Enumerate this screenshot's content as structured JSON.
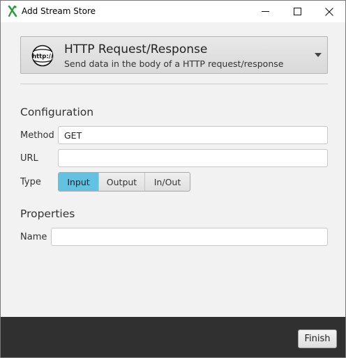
{
  "window": {
    "title": "Add Stream Store"
  },
  "store_select": {
    "title": "HTTP Request/Response",
    "description": "Send data in the body of a HTTP request/response",
    "icon": "http-globe-icon"
  },
  "configuration": {
    "heading": "Configuration",
    "method_label": "Method",
    "method_value": "GET",
    "url_label": "URL",
    "url_value": "",
    "type_label": "Type",
    "type_options": [
      "Input",
      "Output",
      "In/Out"
    ],
    "type_selected": "Input"
  },
  "properties": {
    "heading": "Properties",
    "name_label": "Name",
    "name_value": ""
  },
  "footer": {
    "finish_label": "Finish"
  },
  "colors": {
    "accent": "#63c1e2",
    "footer_bg": "#303030",
    "app_icon": "#2e9a3a"
  }
}
